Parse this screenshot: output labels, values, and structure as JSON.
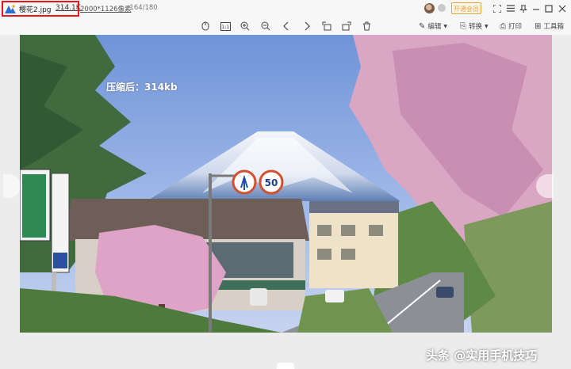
{
  "title_bar": {
    "file_name": "樱花2.jpg",
    "file_size": "314.1K",
    "dimensions": "2000*1126像素",
    "position": "164/180",
    "vip_button": "开通会员",
    "highlight_color": "#e8161b"
  },
  "toolbar": {
    "tools": [
      "original-size",
      "fit",
      "zoom-in",
      "zoom-out",
      "previous",
      "next",
      "rotate-left",
      "rotate-right",
      "delete"
    ],
    "edit_label": "编辑",
    "convert_label": "转换",
    "print_label": "打印",
    "toolbox_label": "工具箱"
  },
  "photo": {
    "caption": "压缩后：314kb",
    "sign_speed": "50",
    "watermark": "头条 @实用手机技巧"
  }
}
